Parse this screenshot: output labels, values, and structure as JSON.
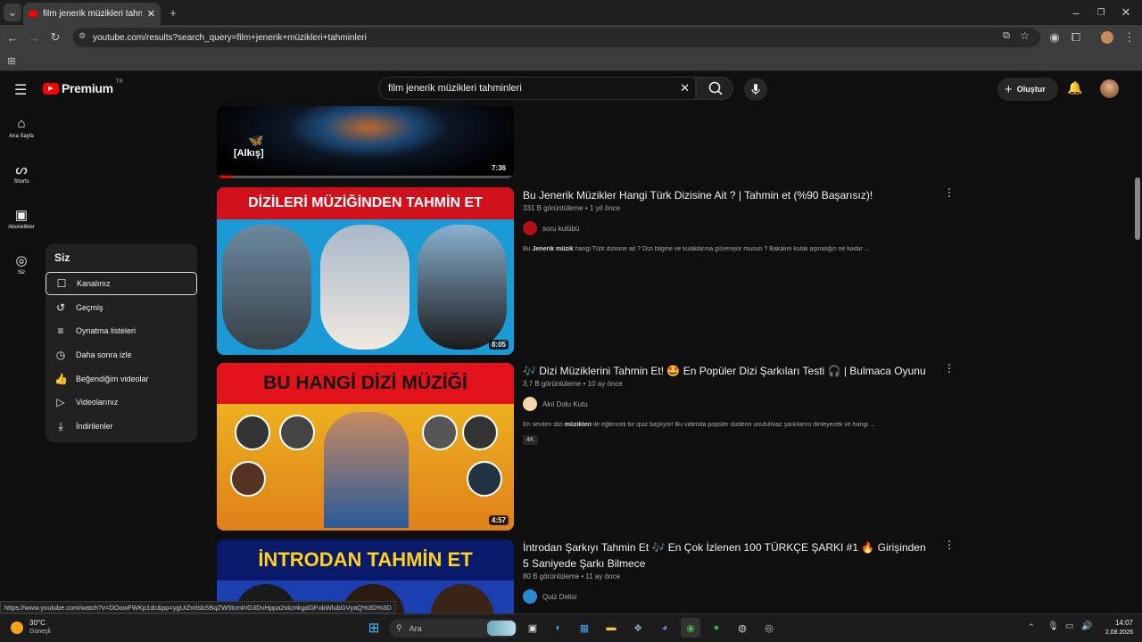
{
  "browser": {
    "tab_title": "film jenerik müzikleri tahminleri",
    "url": "youtube.com/results?search_query=film+jenerik+müzikleri+tahminleri",
    "status_url": "https://www.youtube.com/watch?v=DOowFWKp1dc&pp=ygUiZmlsbSBqZW5lcmlrIG3DvHppa2xlcmkgdGFobWlubGVyaQ%3D%3D"
  },
  "header": {
    "logo_text": "Premium",
    "logo_badge": "TR",
    "search_value": "film jenerik müzikleri tahminleri",
    "create_label": "Oluştur"
  },
  "sidebar": [
    {
      "label": "Ana Sayfa",
      "icon": "home-icon"
    },
    {
      "label": "Shorts",
      "icon": "shorts-icon"
    },
    {
      "label": "Abonelikler",
      "icon": "subscriptions-icon"
    },
    {
      "label": "Siz",
      "icon": "you-icon"
    }
  ],
  "menu": {
    "title": "Siz",
    "items": [
      {
        "label": "Kanalınız",
        "icon": "channel-icon"
      },
      {
        "label": "Geçmiş",
        "icon": "history-icon"
      },
      {
        "label": "Oynatma listeleri",
        "icon": "playlist-icon"
      },
      {
        "label": "Daha sonra izle",
        "icon": "clock-icon"
      },
      {
        "label": "Beğendiğim videolar",
        "icon": "like-icon"
      },
      {
        "label": "Videolarınız",
        "icon": "video-icon"
      },
      {
        "label": "İndirilenler",
        "icon": "download-icon"
      }
    ]
  },
  "results": [
    {
      "duration": "7:36",
      "thumb_text": "[Alkış]"
    },
    {
      "title": "Bu Jenerik Müzikler Hangi Türk Dizisine Ait ? | Tahmin et (%90 Başarısız)!",
      "views": "331 B görüntüleme",
      "age": "1 yıl önce",
      "channel": "soru kulübü",
      "desc_pre": "Bu ",
      "desc_bold": "Jenerik müzik",
      "desc_post": " hangi Türk dizisine ait ? Dizi bilgine ve kulaklarına güveniyor musun ? Bakalım kulak aşinalığın ne kadar ...",
      "duration": "8:05",
      "thumb_text": "DİZİLERİ MÜZİĞİNDEN TAHMİN ET",
      "badge": ""
    },
    {
      "title": "🎶 Dizi Müziklerini Tahmin Et! 🤩 En Popüler Dizi Şarkıları Testi 🎧 | Bulmaca Oyunu",
      "views": "3,7 B görüntüleme",
      "age": "10 ay önce",
      "channel": "Akıl Dolu Kutu",
      "desc_pre": "En sevilen dizi ",
      "desc_bold": "müzikleri",
      "desc_post": " ile eğlenceli bir quiz başlıyor! Bu videoda popüler dizilerin unutulmaz şarkılarını dinleyecek ve hangi ...",
      "duration": "4:57",
      "thumb_text": "BU HANGİ DİZİ MÜZİĞİ",
      "badge": "4K"
    },
    {
      "title": "İntrodan Şarkıyı Tahmin Et 🎶 En Çok İzlenen 100 TÜRKÇE ŞARKI #1 🔥 Girişinden 5 Saniyede Şarkı Bilmece",
      "views": "80 B görüntüleme",
      "age": "11 ay önce",
      "channel": "Quiz Delisi",
      "thumb_text": "İNTRODAN TAHMİN ET"
    }
  ],
  "taskbar": {
    "temp": "30°C",
    "weather": "Güneşli",
    "search_placeholder": "Ara",
    "time": "14:07",
    "date": "2.08.2026"
  },
  "colors": {
    "accent_red": "#ff0000",
    "menu_bg": "#212121"
  }
}
